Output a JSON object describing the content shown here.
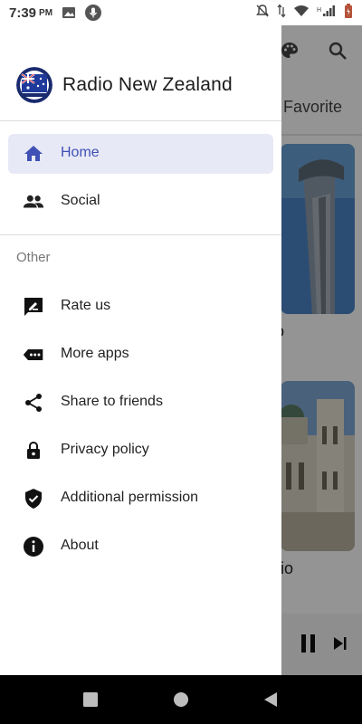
{
  "status_bar": {
    "time": "7:39",
    "ampm": "PM"
  },
  "drawer": {
    "app_name": "Radio New Zealand",
    "primary_items": [
      {
        "label": "Home",
        "icon": "home-icon",
        "active": true
      },
      {
        "label": "Social",
        "icon": "people-icon",
        "active": false
      }
    ],
    "section_label": "Other",
    "other_items": [
      {
        "label": "Rate us",
        "icon": "rate-icon"
      },
      {
        "label": "More apps",
        "icon": "more-apps-icon"
      },
      {
        "label": "Share to friends",
        "icon": "share-icon"
      },
      {
        "label": "Privacy policy",
        "icon": "lock-icon"
      },
      {
        "label": "Additional permission",
        "icon": "shield-check-icon"
      },
      {
        "label": "About",
        "icon": "info-icon"
      }
    ]
  },
  "background_app": {
    "tab_favorite": "Favorite",
    "card1_title": "dio",
    "card2_title": "adio"
  },
  "colors": {
    "accent": "#3f51b5",
    "active_bg": "#e8e9f6"
  }
}
